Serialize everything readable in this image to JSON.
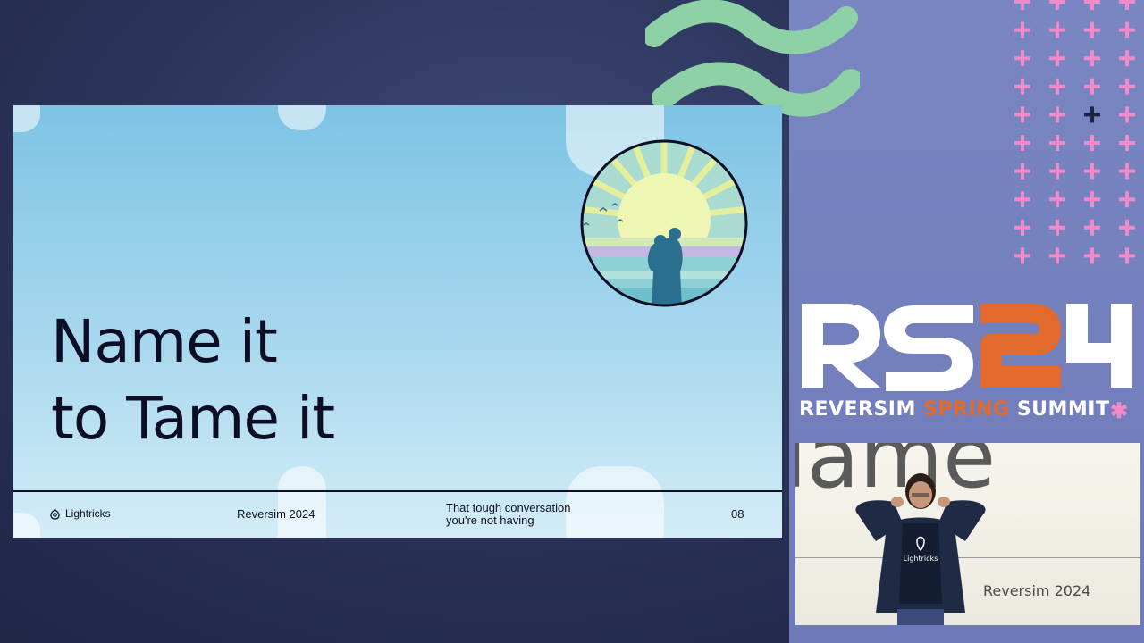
{
  "slide": {
    "title_line1": "Name it",
    "title_line2": "to Tame it",
    "footer": {
      "brand": "Lightricks",
      "event": "Reversim 2024",
      "topic_line1": "That tough conversation",
      "topic_line2": "you're not having",
      "page_number": "08"
    }
  },
  "branding": {
    "logo_text": "RS24",
    "summit_word1": "REVERSIM",
    "summit_word2": "SPRING",
    "summit_word3": "SUMMIT",
    "star": "✱"
  },
  "camera": {
    "background_word": "Tame",
    "event_label": "Reversim 2024",
    "shirt_brand": "Lightricks"
  },
  "colors": {
    "panel": "#7a86c2",
    "accent_orange": "#e36a2d",
    "accent_pink": "#f08ac8",
    "accent_mint": "#8ed1a6",
    "slide_text": "#0c0e26"
  }
}
